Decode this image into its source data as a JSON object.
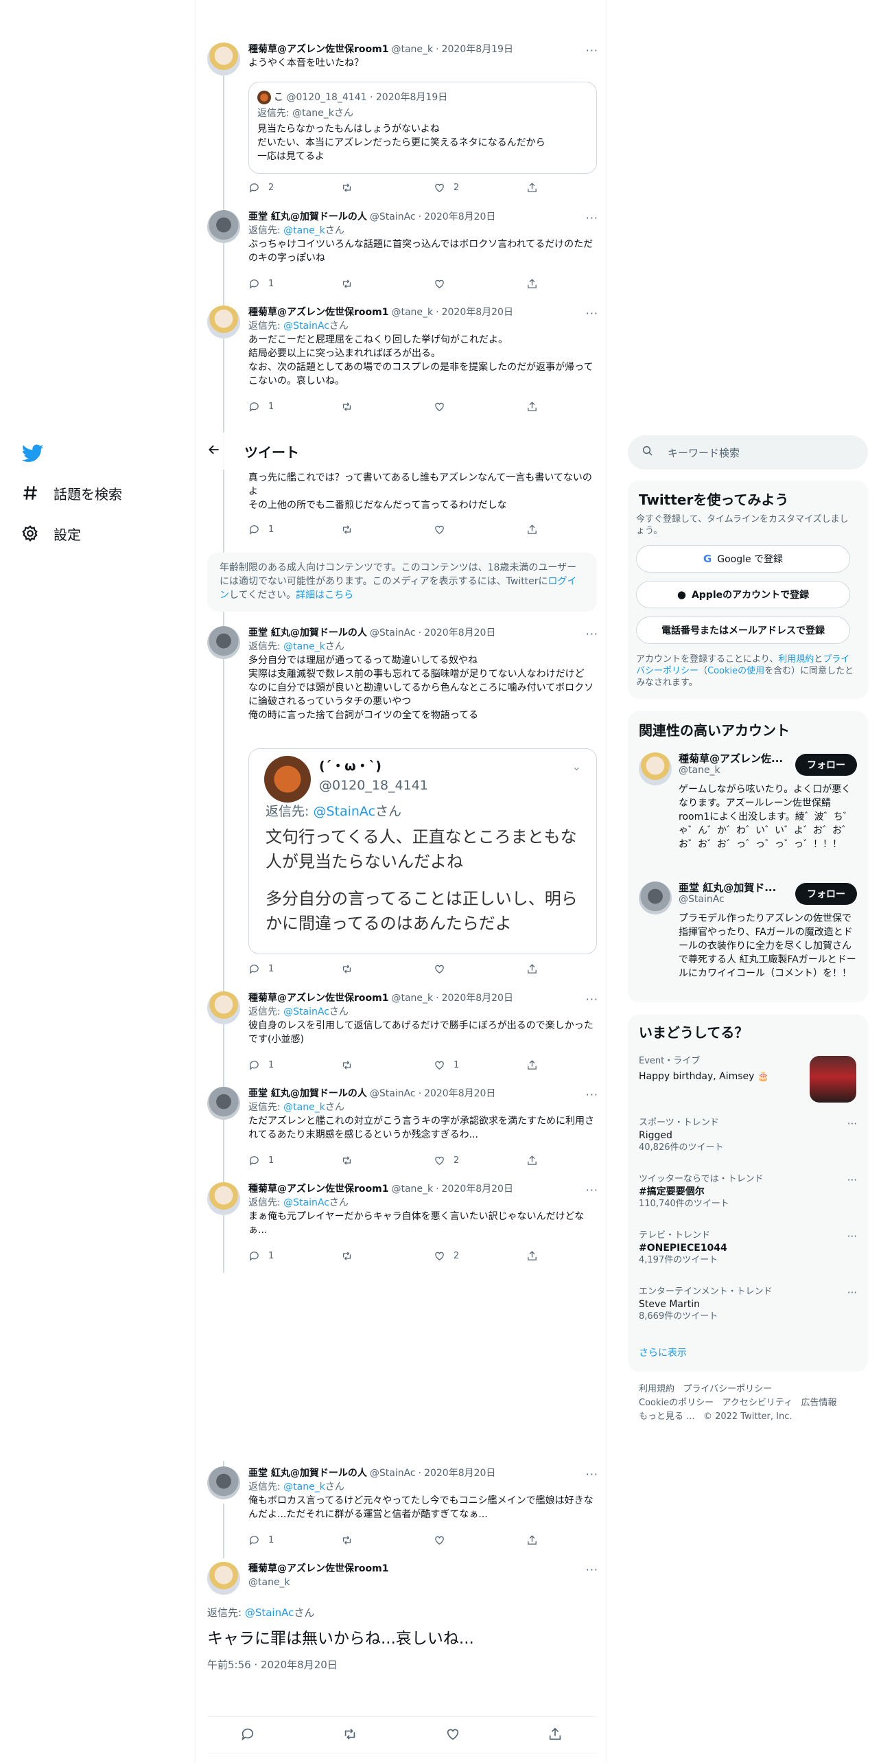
{
  "nav": {
    "explore_label": "話題を検索",
    "settings_label": "設定"
  },
  "header": {
    "title": "ツイート"
  },
  "tweets": [
    {
      "name": "種菊草@アズレン佐世保room1",
      "handle": "@tane_k",
      "date": "2020年8月19日",
      "reply_to": "",
      "reply_handle": "",
      "reply_suffix": "",
      "text": "ようやく本音を吐いたね？",
      "replies": "2",
      "retweets": "",
      "likes": "2"
    },
    {
      "name": "亜堂 紅丸@加賀ドールの人",
      "handle": "@StainAc",
      "date": "2020年8月20日",
      "reply_to": "返信先: ",
      "reply_handle": "@tane_k",
      "reply_suffix": "さん",
      "text": "ぶっちゃけコイツいろんな話題に首突っ込んではボロクソ言われてるだけのただのキの字っぽいね",
      "replies": "1",
      "retweets": "",
      "likes": ""
    },
    {
      "name": "種菊草@アズレン佐世保room1",
      "handle": "@tane_k",
      "date": "2020年8月20日",
      "reply_to": "返信先: ",
      "reply_handle": "@StainAc",
      "reply_suffix": "さん",
      "text": "あーだこーだと屁理屈をこねくり回した挙げ句がこれだよ。\n結局必要以上に突っ込まれればぼろが出る。\nなお、次の話題としてあの場でのコスプレの是非を提案したのだが返事が帰ってこないの。哀しいね。",
      "replies": "1",
      "retweets": "",
      "likes": ""
    },
    {
      "name": "亜堂 紅丸@加賀ドールの人",
      "handle": "@StainAc",
      "date": "2020年8月20日",
      "reply_to": "",
      "reply_handle": "",
      "reply_suffix": "",
      "text": "真っ先に艦これでは？って書いてあるし誰もアズレンなんて一言も書いてないのよ\nその上他の所でも二番煎じだなんだって言ってるわけだしな",
      "replies": "1",
      "retweets": "",
      "likes": ""
    },
    {
      "name": "亜堂 紅丸@加賀ドールの人",
      "handle": "@StainAc",
      "date": "2020年8月20日",
      "reply_to": "返信先: ",
      "reply_handle": "@tane_k",
      "reply_suffix": "さん",
      "text": "多分自分では理屈が通ってるって勘違いしてる奴やね\n実際は支離滅裂で数レス前の事も忘れてる脳味噌が足りてない人なわけだけど\nなのに自分では頭が良いと勘違いしてるから色んなところに噛み付いてボロクソに論破されるっていうタチの悪いやつ\n俺の時に言った捨て台詞がコイツの全てを物語ってる",
      "replies": "1",
      "retweets": "",
      "likes": ""
    },
    {
      "name": "種菊草@アズレン佐世保room1",
      "handle": "@tane_k",
      "date": "2020年8月20日",
      "reply_to": "返信先: ",
      "reply_handle": "@StainAc",
      "reply_suffix": "さん",
      "text": "彼自身のレスを引用して返信してあげるだけで勝手にぼろが出るので楽しかったです(小並感)",
      "replies": "1",
      "retweets": "",
      "likes": "1"
    },
    {
      "name": "亜堂 紅丸@加賀ドールの人",
      "handle": "@StainAc",
      "date": "2020年8月20日",
      "reply_to": "返信先: ",
      "reply_handle": "@tane_k",
      "reply_suffix": "さん",
      "text": "ただアズレンと艦これの対立がこう言うキの字が承認欲求を満たすために利用されてるあたり末期感を感じるというか残念すぎるわ...",
      "replies": "1",
      "retweets": "",
      "likes": "2"
    },
    {
      "name": "種菊草@アズレン佐世保room1",
      "handle": "@tane_k",
      "date": "2020年8月20日",
      "reply_to": "返信先: ",
      "reply_handle": "@StainAc",
      "reply_suffix": "さん",
      "text": "まぁ俺も元プレイヤーだからキャラ自体を悪く言いたい訳じゃないんだけどなぁ...",
      "replies": "1",
      "retweets": "",
      "likes": "2"
    },
    {
      "name": "亜堂 紅丸@加賀ドールの人",
      "handle": "@StainAc",
      "date": "2020年8月20日",
      "reply_to": "返信先: ",
      "reply_handle": "@tane_k",
      "reply_suffix": "さん",
      "text": "俺もボロカス言ってるけど元々やってたし今でもコニシ艦メインで艦娘は好きなんだよ...ただそれに群がる運営と信者が酷すぎてなぁ...",
      "replies": "1",
      "retweets": "",
      "likes": ""
    }
  ],
  "quote1": {
    "handle": "@0120_18_4141",
    "date": "2020年8月19日",
    "name_prefix": "こ",
    "reply": "返信先: @tane_kさん",
    "text": "見当たらなかったもんはしょうがないよね\nだいたい、本当にアズレンだったら更に笑えるネタになるんだから\n一応は見てるよ"
  },
  "banner": {
    "text": "年齢制限のある成人向けコンテンツです。このコンテンツは、18歳未満のユーザーには適切でない可能性があります。このメディアを表示するには、Twitterに",
    "login": "ログイン",
    "mid": "してください。",
    "more": "詳細はこちら"
  },
  "quote2": {
    "name": "(´・ω・`)",
    "handle": "@0120_18_4141",
    "reply_to": "返信先: ",
    "reply_handle": "@StainAc",
    "reply_suffix": "さん",
    "text1": "文句行ってくる人、正直なところまともな人が見当たらないんだよね",
    "text2": "多分自分の言ってることは正しいし、明らかに間違ってるのはあんたらだよ"
  },
  "focus": {
    "name": "種菊草@アズレン佐世保room1",
    "handle": "@tane_k",
    "reply_to": "返信先: ",
    "reply_handle": "@StainAc",
    "reply_suffix": "さん",
    "text": "キャラに罪は無いからね...哀しいね...",
    "timestamp": "午前5:56 · 2020年8月20日"
  },
  "search": {
    "placeholder": "キーワード検索"
  },
  "signup": {
    "title": "Twitterを使ってみよう",
    "subtitle": "今すぐ登録して、タイムラインをカスタマイズしましょう。",
    "google": "Google で登録",
    "apple": "Appleのアカウントで登録",
    "phone": "電話番号またはメールアドレスで登録",
    "terms_a": "アカウントを登録することにより、",
    "terms_link1": "利用規約",
    "terms_b": "と",
    "terms_link2": "プライバシーポリシー",
    "terms_c": "（",
    "terms_link3": "Cookieの使用",
    "terms_d": "を含む）に同意したとみなされます。"
  },
  "related": {
    "title": "関連性の高いアカウント",
    "follow_label": "フォロー",
    "accounts": [
      {
        "name": "種菊草@アズレン佐...",
        "handle": "@tane_k",
        "bio": "ゲームしながら呟いたり。よく口が悪くなります。アズールレーン佐世保鯖room1によく出没します。綾゛波゛ち゛ゃ゛ん゛か゛わ゛い゛い゛よ゛お゛お゛お゛お゛お゛っ゛っ゛っ゛っ゛！！！"
      },
      {
        "name": "亜堂 紅丸@加賀ド...",
        "handle": "@StainAc",
        "bio": "プラモデル作ったりアズレンの佐世保で指揮官やったり、FAガールの魔改造とドールの衣装作りに全力を尽くし加賀さんで尊死する人 紅丸工廠製FAガールとドールにカワイイコール（コメント）を！！"
      }
    ]
  },
  "trends": {
    "title": "いまどうしてる？",
    "event": {
      "cat": "Event・ライブ",
      "name": "Happy birthday, Aimsey 🎂"
    },
    "items": [
      {
        "cat": "スポーツ・トレンド",
        "name": "Rigged",
        "count": "40,826件のツイート"
      },
      {
        "cat": "ツイッターならでは・トレンド",
        "name": "#搞定要要個尔",
        "count": "110,740件のツイート"
      },
      {
        "cat": "テレビ・トレンド",
        "name": "#ONEPIECE1044",
        "count": "4,197件のツイート"
      },
      {
        "cat": "エンターテインメント・トレンド",
        "name": "Steve Martin",
        "count": "8,669件のツイート"
      }
    ],
    "show_more": "さらに表示"
  },
  "footer": {
    "terms": "利用規約",
    "privacy": "プライバシーポリシー",
    "cookie": "Cookieのポリシー",
    "access": "アクセシビリティ",
    "ads": "広告情報",
    "more": "もっと見る ...",
    "copyright": "© 2022 Twitter, Inc."
  },
  "colors": {
    "accent": "#1d9bf0",
    "text": "#0f1419",
    "muted": "#536471"
  }
}
